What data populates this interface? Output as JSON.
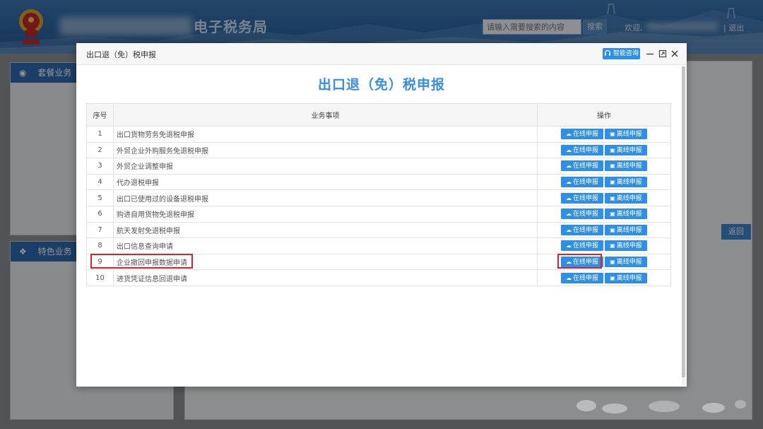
{
  "header": {
    "brand_title": "电子税务局",
    "search_placeholder": "请输入需要搜索的内容",
    "search_button": "搜索",
    "welcome": "欢迎,",
    "logout": "| 退出"
  },
  "left_panels": [
    {
      "label": "套餐业务",
      "icon": "cube-icon"
    },
    {
      "label": "特色业务",
      "icon": "grid-icon"
    }
  ],
  "right_panel": {
    "return_button": "返回"
  },
  "modal": {
    "window_title": "出口退（免）税申报",
    "consult_button": "智能咨询",
    "heading": "出口退（免）税申报",
    "table": {
      "headers": {
        "num": "序号",
        "name": "业务事项",
        "ops": "操作"
      },
      "online_label": "在线申报",
      "offline_label": "离线申报",
      "rows": [
        {
          "num": "1",
          "name": "出口货物劳务免退税申报"
        },
        {
          "num": "2",
          "name": "外贸企业外购服务免退税申报"
        },
        {
          "num": "3",
          "name": "外贸企业调整申报"
        },
        {
          "num": "4",
          "name": "代办退税申报"
        },
        {
          "num": "5",
          "name": "出口已使用过的设备退税申报"
        },
        {
          "num": "6",
          "name": "购进自用货物免退税申报"
        },
        {
          "num": "7",
          "name": "航天发射免退税申报"
        },
        {
          "num": "8",
          "name": "出口信息查询申请"
        },
        {
          "num": "9",
          "name": "企业撤回申报数据申请"
        },
        {
          "num": "10",
          "name": "进货凭证信息回退申请"
        }
      ]
    }
  },
  "colors": {
    "accent": "#2f8fe6",
    "header": "#2e6aa8",
    "highlight": "#d6262b"
  }
}
